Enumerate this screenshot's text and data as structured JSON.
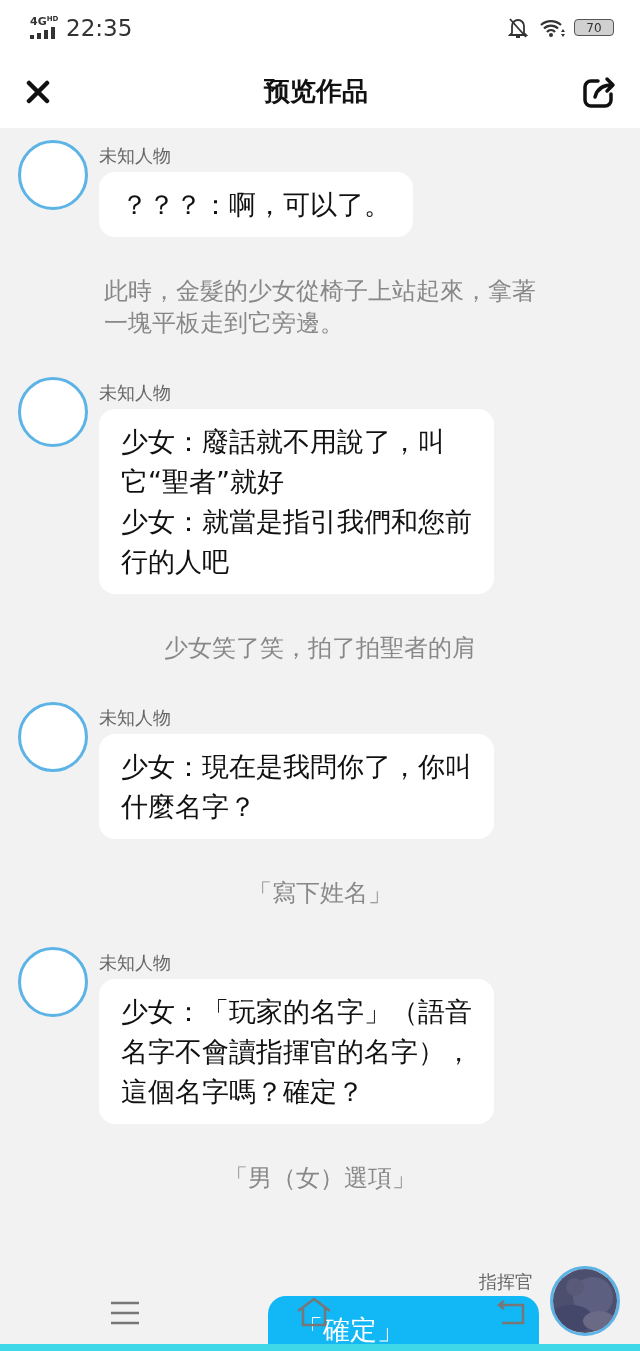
{
  "status_bar": {
    "network": "4G",
    "network_badge": "HD",
    "time": "22:35",
    "battery": "70"
  },
  "header": {
    "title": "预览作品"
  },
  "messages": [
    {
      "kind": "npc",
      "name": "未知人物",
      "lines": [
        "？？？：啊，可以了。"
      ]
    },
    {
      "kind": "narration",
      "lines": [
        "此時，金髮的少女從椅子上站起來，拿著",
        "一塊平板走到它旁邊。"
      ]
    },
    {
      "kind": "npc",
      "name": "未知人物",
      "lines": [
        "少女：廢話就不用說了，叫",
        "它“聖者”就好",
        "少女：就當是指引我們和您前",
        "行的人吧"
      ]
    },
    {
      "kind": "narration",
      "lines": [
        "少女笑了笑，拍了拍聖者的肩"
      ]
    },
    {
      "kind": "npc",
      "name": "未知人物",
      "lines": [
        "少女：現在是我問你了，你叫",
        "什麼名字？"
      ]
    },
    {
      "kind": "narration",
      "lines": [
        "「寫下姓名」"
      ]
    },
    {
      "kind": "npc",
      "name": "未知人物",
      "lines": [
        "少女：「玩家的名字」（語音",
        "名字不會讀指揮官的名字），",
        "這個名字嗎？確定？"
      ]
    },
    {
      "kind": "narration",
      "lines": [
        "「男（女）選項」"
      ]
    },
    {
      "kind": "player",
      "name": "指挥官",
      "lines": [
        "「確定」"
      ]
    }
  ]
}
